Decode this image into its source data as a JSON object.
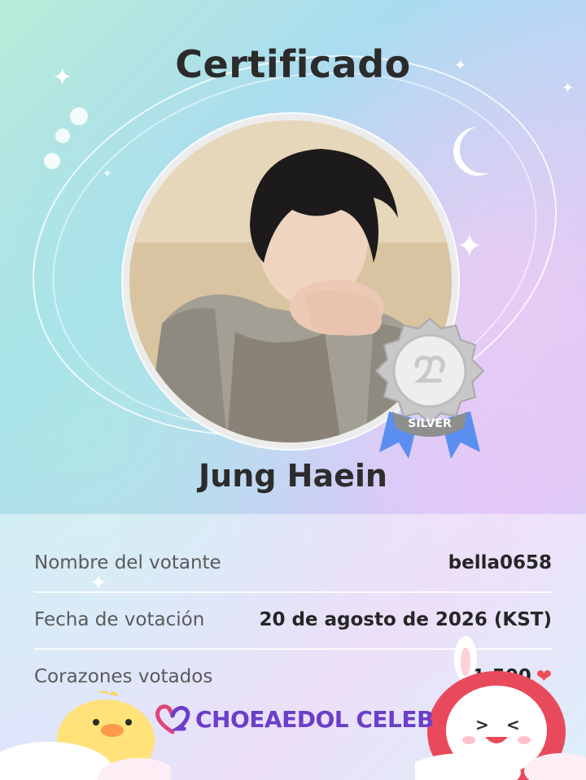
{
  "certificate": {
    "title": "Certificado",
    "celeb_name": "Jung Haein",
    "badge_level": "SILVER"
  },
  "details": [
    {
      "label": "Nombre del votante",
      "value": "bella0658"
    },
    {
      "label": "Fecha de votación",
      "value": "20 de agosto de 2026 (KST)"
    },
    {
      "label": "Corazones votados",
      "value": "1.500"
    }
  ],
  "brand": {
    "name": "CHOEAEDOL CELEB"
  },
  "colors": {
    "heart": "#ef4b5a",
    "brand": "#6b3fc9",
    "badge_ribbon": "#5a8ff0"
  },
  "icons": {
    "heart": "heart-icon",
    "logo": "choeaedol-heart-logo-icon"
  }
}
